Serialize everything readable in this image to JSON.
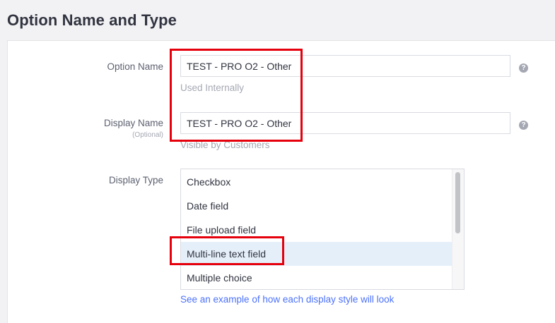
{
  "page_title": "Option Name and Type",
  "option_name": {
    "label": "Option Name",
    "value": "TEST - PRO O2 - Other",
    "help_text": "Used Internally",
    "help_icon": "question-circle-icon"
  },
  "display_name": {
    "label": "Display Name",
    "sublabel": "(Optional)",
    "value": "TEST - PRO O2 - Other",
    "help_text": "Visible by Customers",
    "help_icon": "question-circle-icon"
  },
  "display_type": {
    "label": "Display Type",
    "options": [
      "Checkbox",
      "Date field",
      "File upload field",
      "Multi-line text field",
      "Multiple choice"
    ],
    "selected": "Multi-line text field",
    "example_link": "See an example of how each display style will look"
  },
  "help_glyph": "?",
  "annotation_color": "#e5000c"
}
